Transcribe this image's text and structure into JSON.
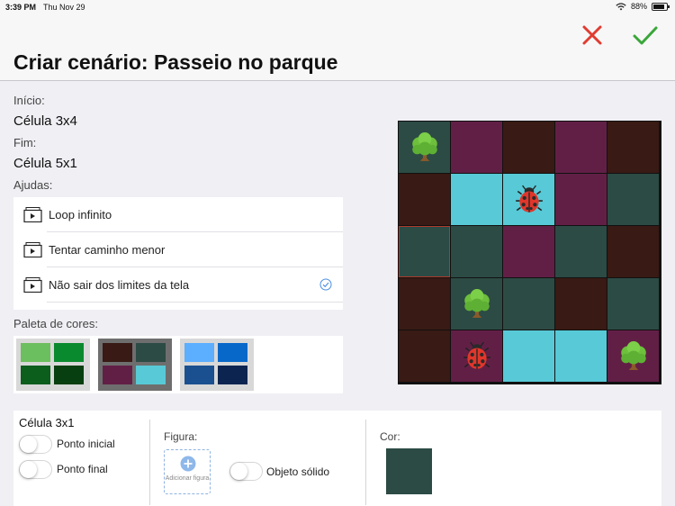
{
  "status_bar": {
    "time": "3:39 PM",
    "date": "Thu Nov 29",
    "battery": "88%",
    "battery_level": 0.88
  },
  "header": {
    "title": "Criar cenário: Passeio no parque",
    "cancel_icon": "close-icon",
    "confirm_icon": "checkmark-icon"
  },
  "start": {
    "label": "Início:",
    "value": "Célula 3x4"
  },
  "end": {
    "label": "Fim:",
    "value": "Célula 5x1"
  },
  "helps": {
    "label": "Ajudas:",
    "items": [
      {
        "label": "Loop infinito",
        "checked": false
      },
      {
        "label": "Tentar caminho menor",
        "checked": false
      },
      {
        "label": "Não sair dos limites da tela",
        "checked": true
      }
    ]
  },
  "palette": {
    "label": "Paleta de cores:",
    "selected_index": 1,
    "options": [
      {
        "colors": [
          "#6cbf5e",
          "#0a8a2e",
          "#0b5e1c",
          "#073f10"
        ]
      },
      {
        "colors": [
          "#391a14",
          "#2c4b44",
          "#621f46",
          "#58c9d6"
        ]
      },
      {
        "colors": [
          "#5caeff",
          "#0868c9",
          "#1b5090",
          "#0b2550"
        ]
      }
    ]
  },
  "board": {
    "rows": 5,
    "cols": 5,
    "colors": {
      "brown": "#391a14",
      "green": "#2c4b44",
      "purple": "#621f46",
      "cyan": "#58c9d6"
    },
    "cells": [
      [
        "green",
        "purple",
        "brown",
        "purple",
        "brown"
      ],
      [
        "brown",
        "cyan",
        "cyan",
        "purple",
        "green"
      ],
      [
        "green",
        "green",
        "purple",
        "green",
        "brown"
      ],
      [
        "brown",
        "green",
        "green",
        "brown",
        "green"
      ],
      [
        "brown",
        "purple",
        "cyan",
        "cyan",
        "purple"
      ]
    ],
    "selected": [
      2,
      0
    ],
    "figures": [
      {
        "row": 0,
        "col": 0,
        "icon": "tree-icon"
      },
      {
        "row": 1,
        "col": 2,
        "icon": "ladybug-icon"
      },
      {
        "row": 3,
        "col": 1,
        "icon": "tree-icon"
      },
      {
        "row": 4,
        "col": 1,
        "icon": "ladybug-icon"
      },
      {
        "row": 4,
        "col": 4,
        "icon": "tree-icon"
      }
    ]
  },
  "editor": {
    "cell_title": "Célula 3x1",
    "start_point_label": "Ponto inicial",
    "end_point_label": "Ponto final",
    "figure_label": "Figura:",
    "add_figure_label": "Adicionar figura",
    "solid_object_label": "Objeto sólido",
    "color_label": "Cor:",
    "color_value": "#2c4b44"
  }
}
